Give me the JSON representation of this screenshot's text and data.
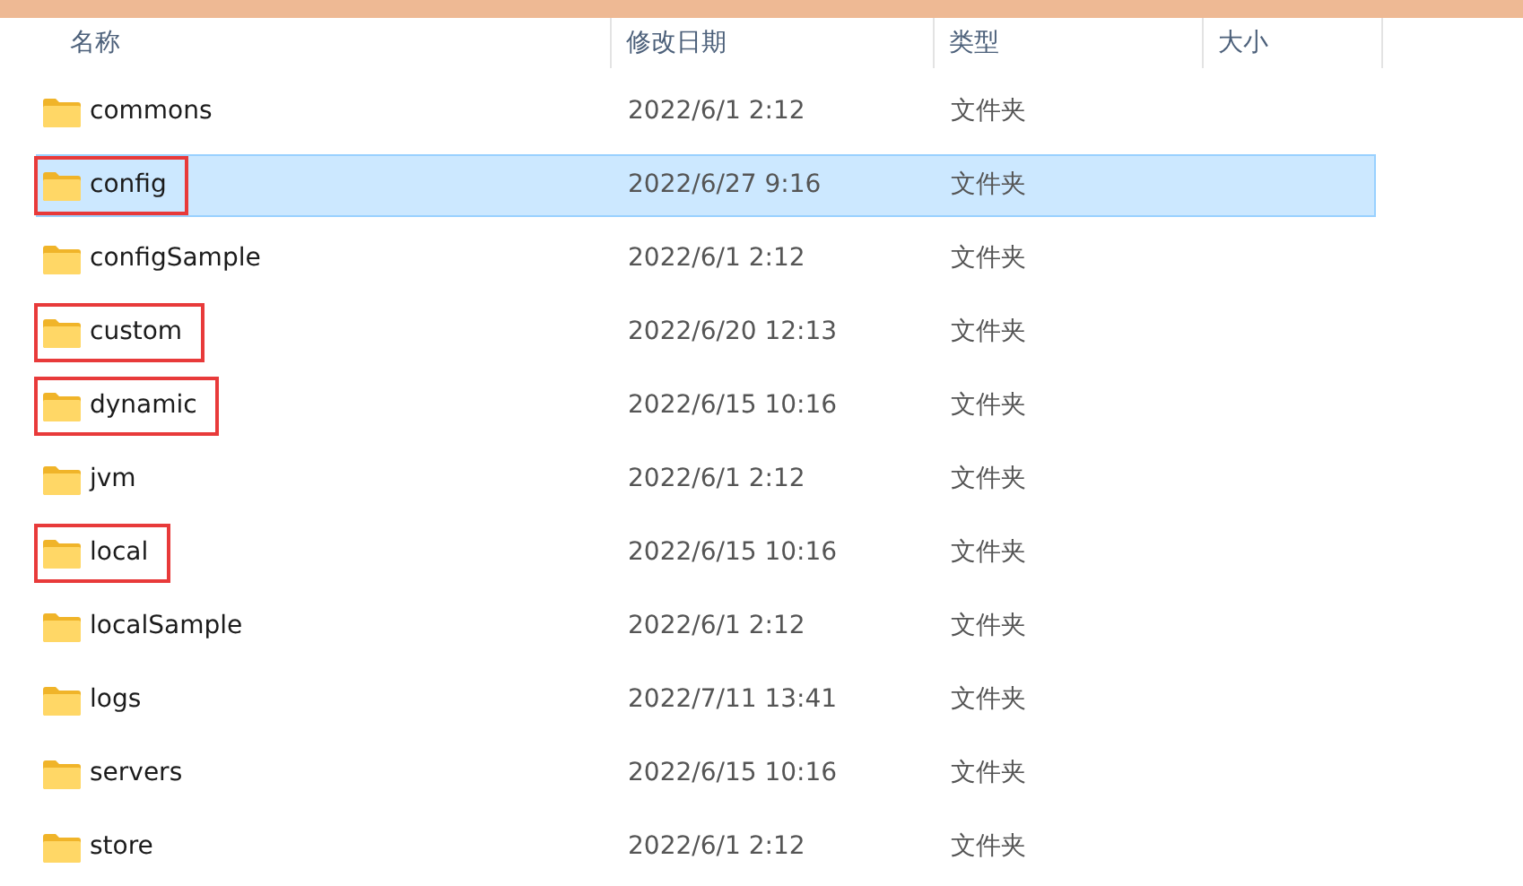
{
  "columns": [
    "名称",
    "修改日期",
    "类型",
    "大小"
  ],
  "rows": [
    {
      "name": "commons",
      "modified": "2022/6/1 2:12",
      "type": "文件夹",
      "selected": false,
      "marked": false
    },
    {
      "name": "config",
      "modified": "2022/6/27 9:16",
      "type": "文件夹",
      "selected": true,
      "marked": true
    },
    {
      "name": "configSample",
      "modified": "2022/6/1 2:12",
      "type": "文件夹",
      "selected": false,
      "marked": false
    },
    {
      "name": "custom",
      "modified": "2022/6/20 12:13",
      "type": "文件夹",
      "selected": false,
      "marked": true
    },
    {
      "name": "dynamic",
      "modified": "2022/6/15 10:16",
      "type": "文件夹",
      "selected": false,
      "marked": true
    },
    {
      "name": "jvm",
      "modified": "2022/6/1 2:12",
      "type": "文件夹",
      "selected": false,
      "marked": false
    },
    {
      "name": "local",
      "modified": "2022/6/15 10:16",
      "type": "文件夹",
      "selected": false,
      "marked": true
    },
    {
      "name": "localSample",
      "modified": "2022/6/1 2:12",
      "type": "文件夹",
      "selected": false,
      "marked": false
    },
    {
      "name": "logs",
      "modified": "2022/7/11 13:41",
      "type": "文件夹",
      "selected": false,
      "marked": false
    },
    {
      "name": "servers",
      "modified": "2022/6/15 10:16",
      "type": "文件夹",
      "selected": false,
      "marked": false
    },
    {
      "name": "store",
      "modified": "2022/6/1 2:12",
      "type": "文件夹",
      "selected": false,
      "marked": false
    }
  ]
}
